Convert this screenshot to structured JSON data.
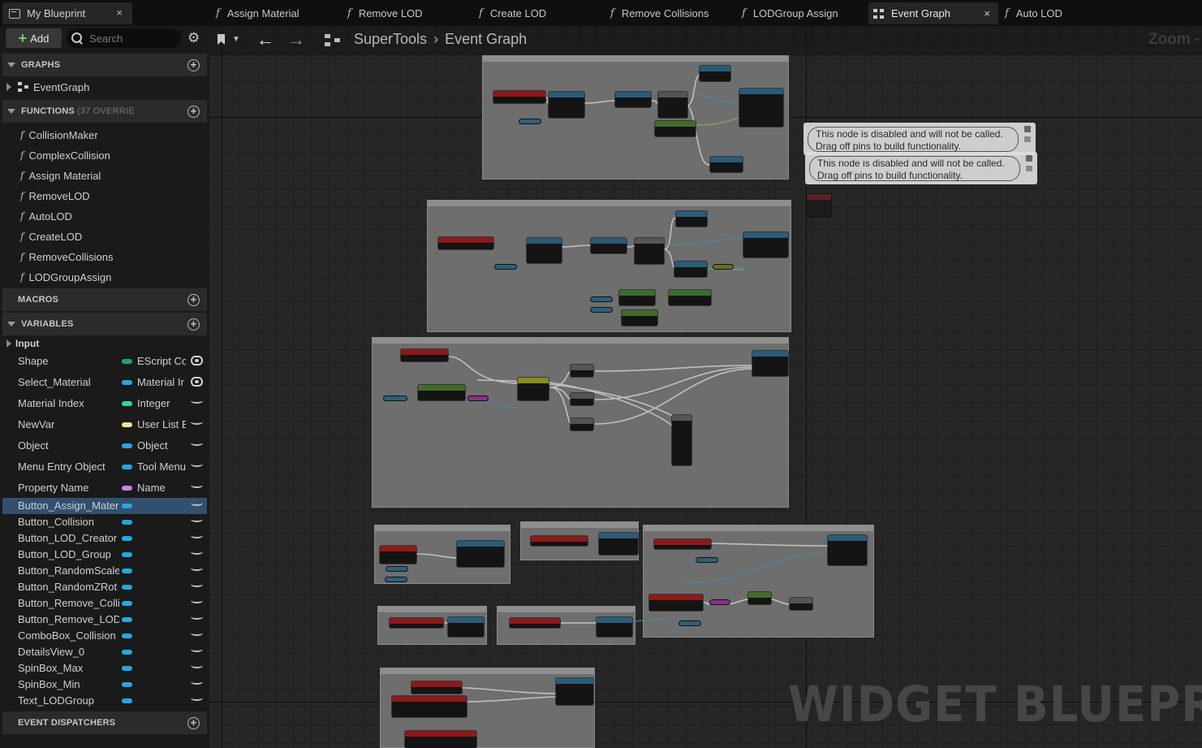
{
  "tabs": {
    "blueprint_tab": "My Blueprint",
    "close_glyph": "×",
    "documents": [
      {
        "label": "Assign Material",
        "icon": "function-icon"
      },
      {
        "label": "Remove LOD",
        "icon": "function-icon"
      },
      {
        "label": "Create LOD",
        "icon": "function-icon"
      },
      {
        "label": "Remove Collisions",
        "icon": "function-icon"
      },
      {
        "label": "LODGroup Assign",
        "icon": "function-icon"
      },
      {
        "label": "Event Graph",
        "icon": "event-graph-icon",
        "active": true
      },
      {
        "label": "Auto LOD",
        "icon": "function-icon"
      }
    ]
  },
  "toolbar": {
    "add_label": "Add",
    "search_placeholder": "Search"
  },
  "sections": {
    "graphs": "GRAPHS",
    "functions": "FUNCTIONS",
    "functions_sub": "(37 OVERRIE",
    "macros": "MACROS",
    "variables": "VARIABLES",
    "event_dispatchers": "EVENT DISPATCHERS"
  },
  "graphs": [
    "EventGraph"
  ],
  "functions": [
    "CollisionMaker",
    "ComplexCollision",
    "Assign Material",
    "RemoveLOD",
    "AutoLOD",
    "CreateLOD",
    "RemoveCollisions",
    "LODGroupAssign"
  ],
  "variables": {
    "category": "Input",
    "inputs": [
      {
        "name": "Shape",
        "type": "EScript Co",
        "color": "#1aa08a",
        "visible": true
      },
      {
        "name": "Select_Material",
        "type": "Material Ir",
        "color": "#27a7e0",
        "visible": true
      },
      {
        "name": "Material Index",
        "type": "Integer",
        "color": "#2fd6a4",
        "visible": false
      },
      {
        "name": "NewVar",
        "type": "User List E",
        "color": "#e8e49a",
        "visible": false
      },
      {
        "name": "Object",
        "type": "Object",
        "color": "#27a7e0",
        "visible": false
      },
      {
        "name": "Menu Entry Object",
        "type": "Tool Menu",
        "color": "#27a7e0",
        "visible": false
      },
      {
        "name": "Property Name",
        "type": "Name",
        "color": "#c884e6",
        "visible": false
      }
    ],
    "widgets": [
      "Button_Assign_Mater",
      "Button_Collision",
      "Button_LOD_Creator",
      "Button_LOD_Group",
      "Button_RandomScale",
      "Button_RandomZRot",
      "Button_Remove_Colli",
      "Button_Remove_LOD",
      "ComboBox_Collision",
      "DetailsView_0",
      "SpinBox_Max",
      "SpinBox_Min",
      "Text_LODGroup"
    ],
    "widget_color": "#27a7e0",
    "selected": "Button_Assign_Mater"
  },
  "graph": {
    "breadcrumb": [
      "SuperTools",
      "Event Graph"
    ],
    "zoom_label": "Zoom -",
    "disabled_note_line1": "This node is disabled and will not be called.",
    "disabled_note_line2": "Drag off pins to build functionality.",
    "watermark": "WIDGET BLUEPRINT"
  }
}
